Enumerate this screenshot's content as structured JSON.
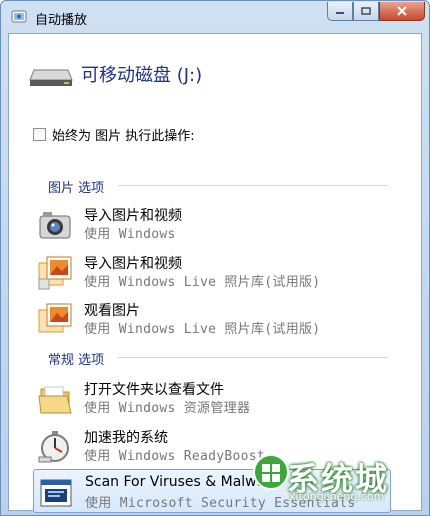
{
  "window": {
    "title": "自动播放"
  },
  "drive": {
    "name": "可移动磁盘 (J:)"
  },
  "always_option": {
    "label": "始终为 图片 执行此操作:"
  },
  "sections": {
    "pictures": "图片 选项",
    "general": "常规 选项"
  },
  "items": [
    {
      "title": "导入图片和视频",
      "sub": "使用 Windows",
      "icon": "camera-icon"
    },
    {
      "title": "导入图片和视频",
      "sub": "使用 Windows Live 照片库(试用版)",
      "icon": "photo-gallery-icon"
    },
    {
      "title": "观看图片",
      "sub": "使用 Windows Live 照片库(试用版)",
      "icon": "photo-gallery-icon"
    },
    {
      "title": "打开文件夹以查看文件",
      "sub": "使用 Windows 资源管理器",
      "icon": "folder-icon"
    },
    {
      "title": "加速我的系统",
      "sub": "使用 Windows ReadyBoost",
      "icon": "stopwatch-icon"
    },
    {
      "title": "Scan For Viruses & Malware",
      "sub": "使用 Microsoft Security Essentials",
      "icon": "security-scan-icon"
    }
  ],
  "watermark": {
    "text": "系统城",
    "url": "xitongcheng.com"
  },
  "colors": {
    "accent": "#1e3287",
    "titlebar": "#c3d8ee",
    "close": "#c9472b"
  }
}
